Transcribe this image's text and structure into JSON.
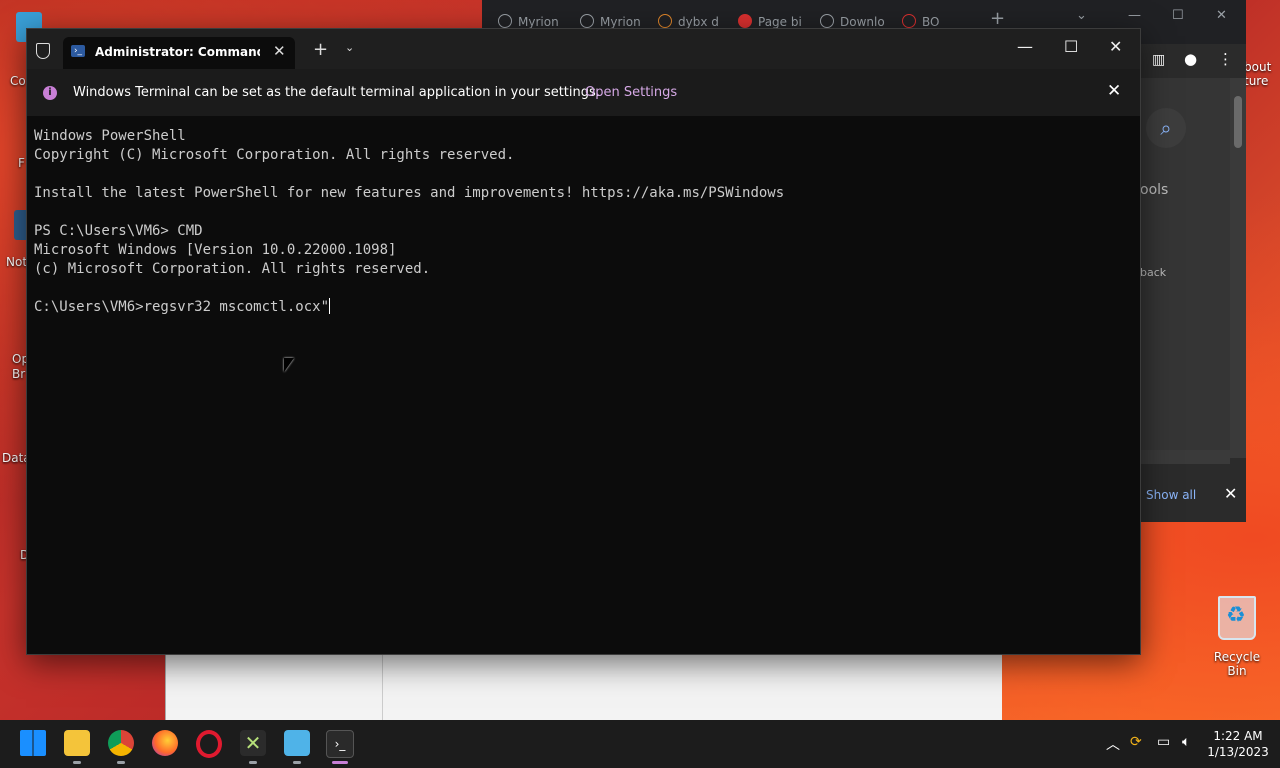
{
  "desktop": {
    "icons": [
      {
        "label": "Co"
      },
      {
        "label": "F"
      },
      {
        "label": "Not"
      },
      {
        "label": "Op\nBr"
      },
      {
        "label": "Data"
      },
      {
        "label": "D"
      }
    ],
    "recycle_bin": "Recycle Bin",
    "right_edge": [
      "bout",
      "ture"
    ]
  },
  "browser": {
    "tabs": [
      "Myrion",
      "Myrion",
      "dybx d",
      "Page bi",
      "Downlo",
      "BO"
    ],
    "sidebar_tools": "ools",
    "back_text": "back",
    "show_all": "Show all"
  },
  "terminal": {
    "tab_title": "Administrator: Command Prompt",
    "info_message": "Windows Terminal can be set as the default terminal application in your settings.",
    "open_settings": "Open Settings",
    "lines": [
      "Windows PowerShell",
      "Copyright (C) Microsoft Corporation. All rights reserved.",
      "",
      "Install the latest PowerShell for new features and improvements! https://aka.ms/PSWindows",
      "",
      "PS C:\\Users\\VM6> CMD",
      "Microsoft Windows [Version 10.0.22000.1098]",
      "(c) Microsoft Corporation. All rights reserved.",
      "",
      "C:\\Users\\VM6>regsvr32 mscomctl.ocx\""
    ]
  },
  "taskbar": {
    "apps": [
      "start-icon",
      "file-explorer-icon",
      "chrome-icon",
      "firefox-icon",
      "opera-icon",
      "xbox-icon",
      "notepad-icon",
      "terminal-icon"
    ],
    "time": "1:22 AM",
    "date": "1/13/2023"
  },
  "colors": {
    "accent_purple": "#c87fd6",
    "console_bg": "#0c0c0c"
  }
}
